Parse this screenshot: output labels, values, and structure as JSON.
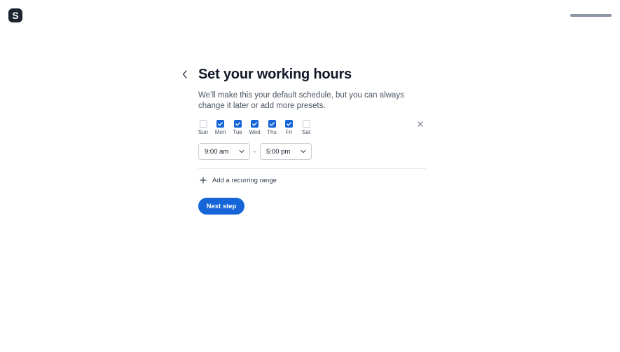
{
  "app": {
    "logo_letter": "S",
    "progress": 1.0,
    "colors": {
      "accent": "#1565d8",
      "logo_bg": "#1c2430"
    }
  },
  "header": {
    "back_icon": "chevron-left-icon",
    "title": "Set your working hours",
    "subtitle": "We’ll make this your default schedule, but you can always change it later or add more presets."
  },
  "days": [
    {
      "label": "Sun",
      "checked": false
    },
    {
      "label": "Mon",
      "checked": true
    },
    {
      "label": "Tue",
      "checked": true
    },
    {
      "label": "Wed",
      "checked": true
    },
    {
      "label": "Thu",
      "checked": true
    },
    {
      "label": "Fri",
      "checked": true
    },
    {
      "label": "Sat",
      "checked": false
    }
  ],
  "range": {
    "start": "9:00 am",
    "separator": "–",
    "end": "5:00 pm",
    "remove_icon": "close-icon"
  },
  "add_range": {
    "label": "Add a recurring range",
    "icon": "plus-icon"
  },
  "next_button": {
    "label": "Next step"
  }
}
